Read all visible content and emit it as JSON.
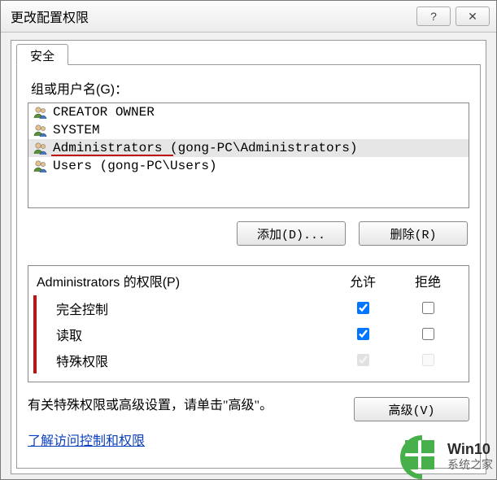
{
  "window": {
    "title": "更改配置权限",
    "help_glyph": "?",
    "close_glyph": "✕"
  },
  "tab": {
    "label": "安全"
  },
  "groups": {
    "label": "组或用户名(G)：",
    "items": [
      {
        "text": "CREATOR OWNER"
      },
      {
        "text": "SYSTEM"
      },
      {
        "text": "Administrators (gong-PC\\Administrators)"
      },
      {
        "text": "Users (gong-PC\\Users)"
      }
    ],
    "selected_index": 2
  },
  "buttons": {
    "add": "添加(D)...",
    "remove": "删除(R)",
    "advanced": "高级(V)"
  },
  "permissions": {
    "header_for": "Administrators 的权限(P)",
    "col_allow": "允许",
    "col_deny": "拒绝",
    "rows": [
      {
        "name": "完全控制",
        "allow": true,
        "deny": false,
        "allow_disabled": false,
        "deny_disabled": false
      },
      {
        "name": "读取",
        "allow": true,
        "deny": false,
        "allow_disabled": false,
        "deny_disabled": false
      },
      {
        "name": "特殊权限",
        "allow": true,
        "deny": false,
        "allow_disabled": true,
        "deny_disabled": true
      }
    ]
  },
  "footer": {
    "text": "有关特殊权限或高级设置，请单击\"高级\"。",
    "link": "了解访问控制和权限"
  },
  "watermark": {
    "line1": "Win10",
    "line2": "系统之家"
  }
}
